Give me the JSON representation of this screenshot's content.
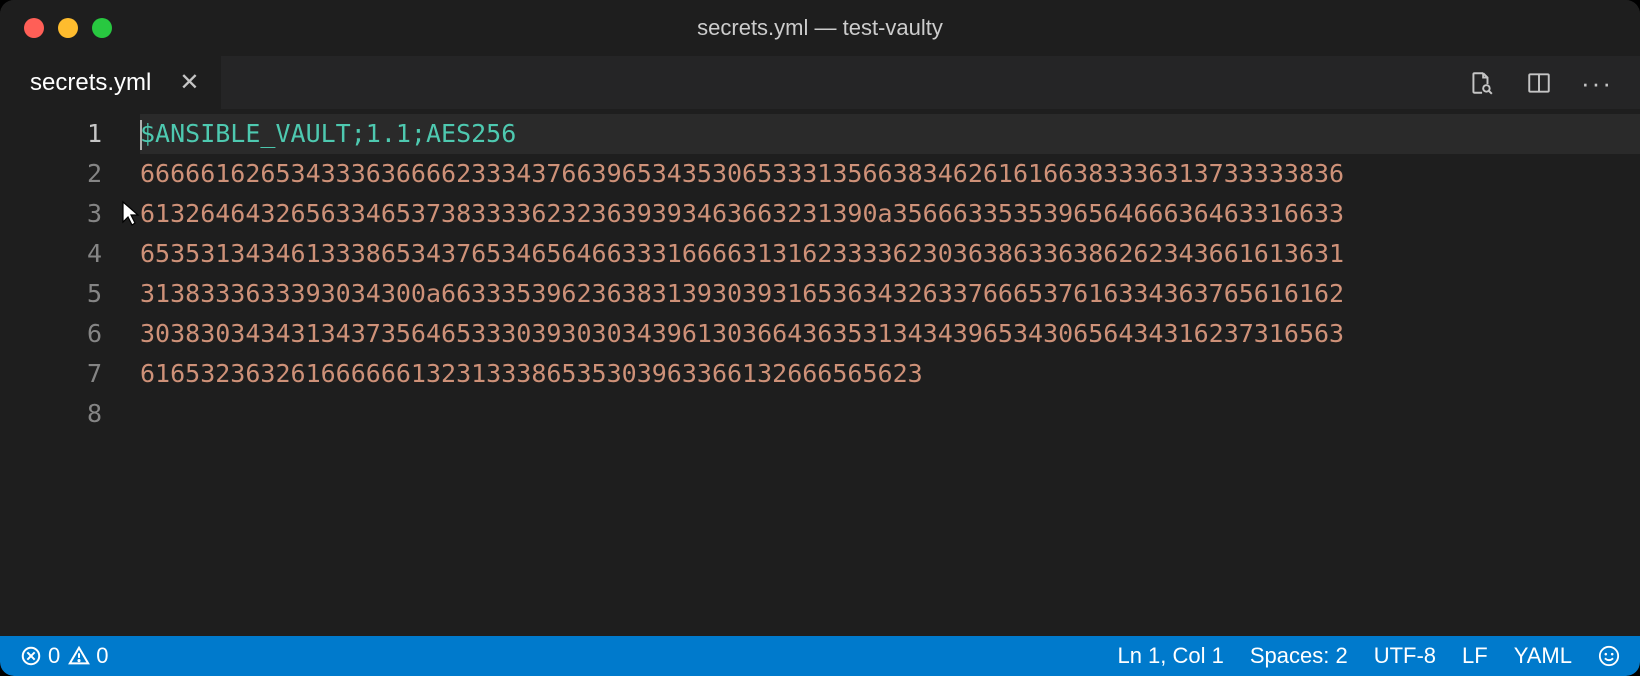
{
  "window": {
    "title": "secrets.yml — test-vaulty"
  },
  "tab": {
    "label": "secrets.yml"
  },
  "editor": {
    "lines": [
      {
        "n": 1,
        "text": "$ANSIBLE_VAULT;1.1;AES256",
        "cls": "tok-green",
        "active": true
      },
      {
        "n": 2,
        "text": "66666162653433363666623334376639653435306533313566383462616166383336313733333836",
        "cls": "tok-orange"
      },
      {
        "n": 3,
        "text": "6132646432656334653738333362323639393463663231390a356663353539656466636463316633",
        "cls": "tok-orange"
      },
      {
        "n": 4,
        "text": "65353134346133386534376534656466333166663131623333623036386336386262343661613631",
        "cls": "tok-orange"
      },
      {
        "n": 5,
        "text": "3138333633393034300a663335396236383139303931653634326337666537616334363765616162",
        "cls": "tok-orange"
      },
      {
        "n": 6,
        "text": "30383034343134373564653330393030343961303664363531343439653430656434316237316563",
        "cls": "tok-orange"
      },
      {
        "n": 7,
        "text": "6165323632616666661323133386535303963366132666565623",
        "cls": "tok-orange"
      },
      {
        "n": 8,
        "text": "",
        "cls": ""
      }
    ]
  },
  "status": {
    "errors": "0",
    "warnings": "0",
    "position": "Ln 1, Col 1",
    "indent": "Spaces: 2",
    "encoding": "UTF-8",
    "eol": "LF",
    "language": "YAML"
  }
}
